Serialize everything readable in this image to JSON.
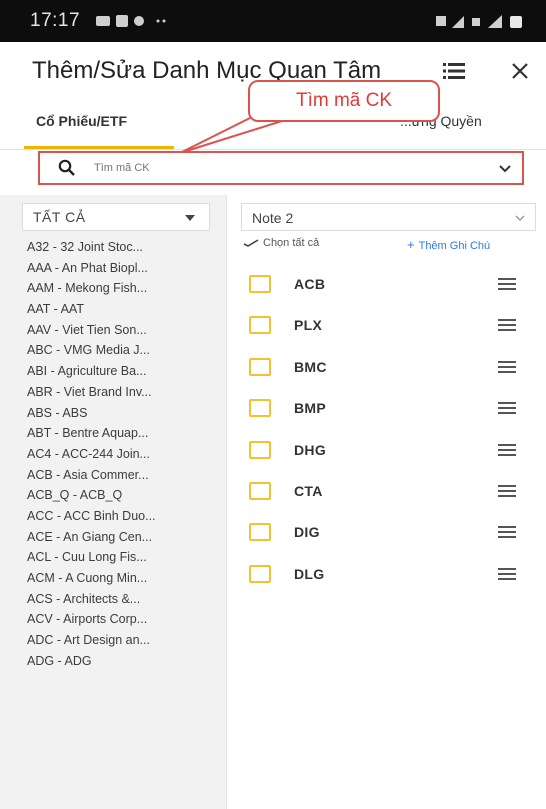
{
  "statusbar": {
    "time": "17:17"
  },
  "header": {
    "title": "Thêm/Sửa Danh Mục Quan Tâm"
  },
  "tabs": {
    "active_label": "Cổ Phiếu/ETF",
    "right_label": "...ứng Quyền"
  },
  "callout": {
    "text": "Tìm mã CK"
  },
  "search": {
    "placeholder": "Tìm mã CK"
  },
  "left": {
    "filter_label": "TẤT CẢ",
    "items": [
      "A32 - 32 Joint Stoc...",
      "AAA - An Phat Biopl...",
      "AAM - Mekong Fish...",
      "AAT - AAT",
      "AAV - Viet Tien Son...",
      "ABC - VMG Media J...",
      "ABI - Agriculture Ba...",
      "ABR - Viet Brand Inv...",
      "ABS - ABS",
      "ABT - Bentre Aquap...",
      "AC4 - ACC-244 Join...",
      "ACB - Asia Commer...",
      "ACB_Q - ACB_Q",
      "ACC - ACC Binh Duo...",
      "ACE - An Giang Cen...",
      "ACL - Cuu Long Fis...",
      "ACM - A Cuong Min...",
      "ACS - Architects &...",
      "ACV - Airports Corp...",
      "ADC - Art Design an...",
      "ADG - ADG"
    ]
  },
  "right": {
    "note_label": "Note 2",
    "select_all_label": "Chọn tất cả",
    "add_note_label": "Thêm Ghi Chú",
    "tickers": [
      "ACB",
      "PLX",
      "BMC",
      "BMP",
      "DHG",
      "CTA",
      "DIG",
      "DLG"
    ]
  },
  "colors": {
    "accent": "#f0b400",
    "highlight": "#d9534f",
    "link": "#2a7be4"
  },
  "icons": [
    "message-icon",
    "sim-icon",
    "list-icon",
    "close-icon",
    "search-icon",
    "chevron-down-icon",
    "checkmark-icon",
    "plus-icon",
    "drag-handle-icon"
  ]
}
